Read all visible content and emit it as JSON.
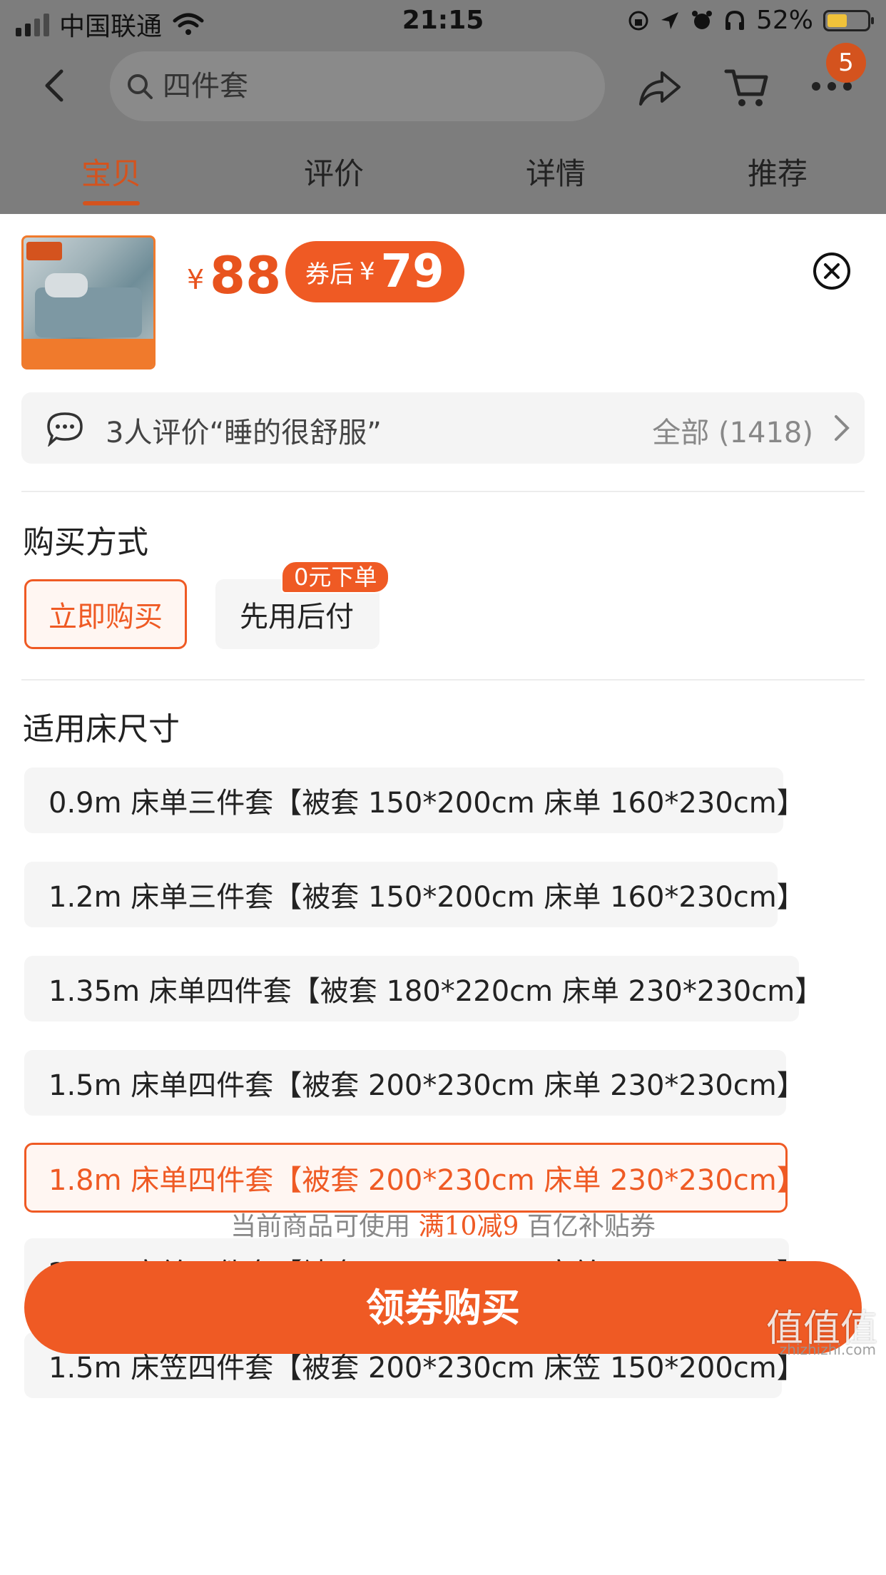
{
  "status_bar": {
    "carrier": "中国联通",
    "time": "21:15",
    "battery_percent": "52%",
    "battery_level": 0.52,
    "battery_color": "#f0c23a"
  },
  "nav": {
    "search_placeholder": "四件套",
    "cart_badge": "5"
  },
  "tabs": [
    {
      "label": "宝贝",
      "active": true
    },
    {
      "label": "评价",
      "active": false
    },
    {
      "label": "详情",
      "active": false
    },
    {
      "label": "推荐",
      "active": false
    }
  ],
  "product": {
    "currency": "¥",
    "price": "88",
    "coupon_label": "券后",
    "coupon_price": "79"
  },
  "review": {
    "text": "3人评价“睡的很舒服”",
    "all": "全部 (1418)"
  },
  "purchase": {
    "title": "购买方式",
    "options": [
      {
        "label": "立即购买",
        "selected": true
      },
      {
        "label": "先用后付",
        "selected": false
      }
    ],
    "promo_tag": "0元下单"
  },
  "sizes": {
    "title": "适用床尺寸",
    "options": [
      {
        "label": "0.9m 床单三件套【被套 150*200cm 床单 160*230cm】",
        "selected": false
      },
      {
        "label": "1.2m 床单三件套【被套 150*200cm 床单 160*230cm】",
        "selected": false
      },
      {
        "label": "1.35m 床单四件套【被套 180*220cm 床单 230*230cm】",
        "selected": false
      },
      {
        "label": "1.5m 床单四件套【被套 200*230cm 床单 230*230cm】",
        "selected": false
      },
      {
        "label": "1.8m 床单四件套【被套 200*230cm 床单 230*230cm】",
        "selected": true
      },
      {
        "label": "2.0m 床单四件套【被套 220*240cm 床单 230*250cm】",
        "selected": false
      },
      {
        "label": "1.5m 床笠四件套【被套 200*230cm 床笠 150*200cm】",
        "selected": false
      }
    ]
  },
  "coupon_note": {
    "prefix": "当前商品可使用",
    "highlight": "满10减9",
    "suffix": "百亿补贴券"
  },
  "buy_button": "领券购买",
  "watermark": "值值值",
  "watermark_sub": "zhizhizhi.com",
  "colors": {
    "accent": "#ef5a24",
    "badge": "#d4531e",
    "backdrop": "#7d7d7d"
  }
}
